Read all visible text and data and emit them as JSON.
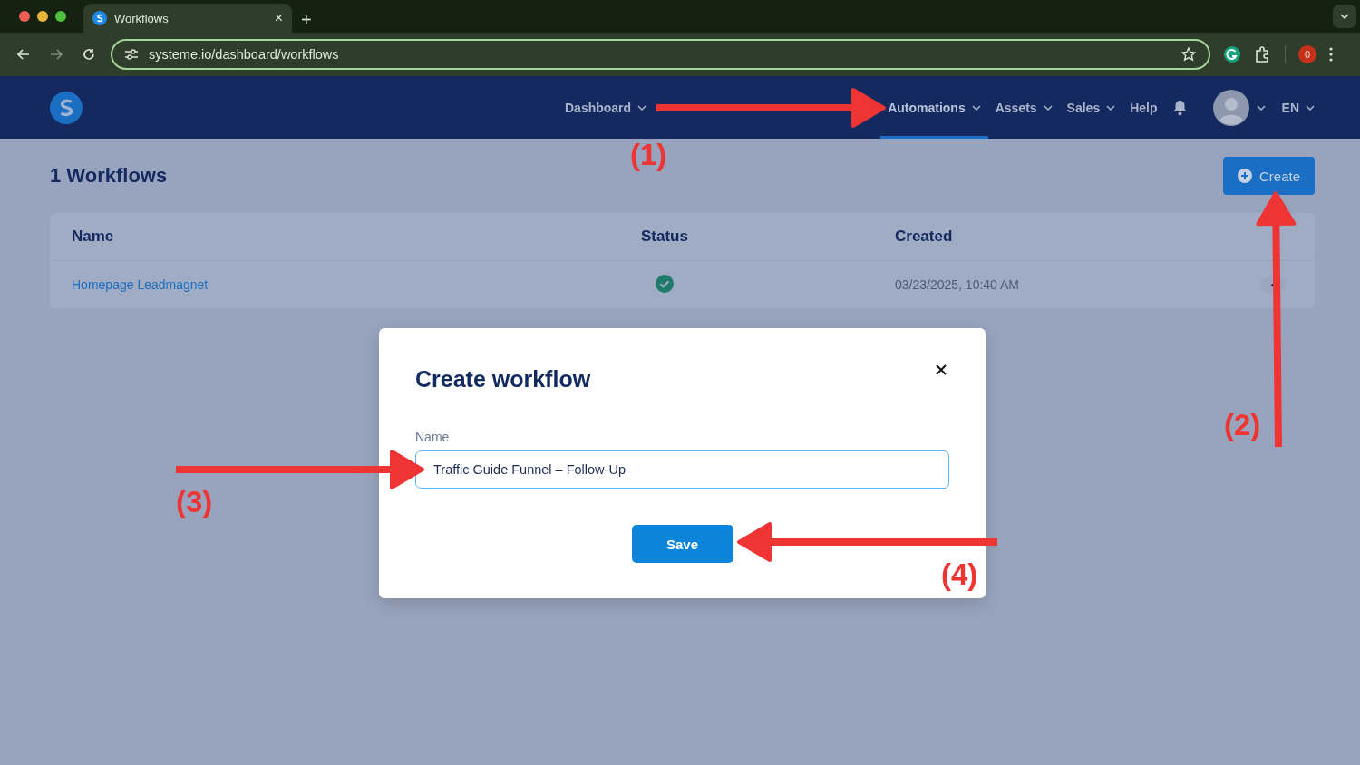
{
  "browser": {
    "tab_title": "Workflows",
    "close_tab": "×",
    "new_tab": "+",
    "url": "systeme.io/dashboard/workflows",
    "extension_badge": "0"
  },
  "nav": {
    "items": [
      {
        "label": "Dashboard",
        "selected": false,
        "dropdown": true
      },
      {
        "label": "Automations",
        "selected": true,
        "dropdown": true
      },
      {
        "label": "Assets",
        "selected": false,
        "dropdown": true
      },
      {
        "label": "Sales",
        "selected": false,
        "dropdown": true
      },
      {
        "label": "Help",
        "selected": false,
        "dropdown": false
      }
    ],
    "language": "EN"
  },
  "page": {
    "title": "1 Workflows",
    "create_button": "Create",
    "table": {
      "columns": [
        "Name",
        "Status",
        "Created"
      ],
      "rows": [
        {
          "name": "Homepage Leadmagnet",
          "active": true,
          "created": "03/23/2025, 10:40 AM"
        }
      ]
    }
  },
  "dialog": {
    "title": "Create workflow",
    "field_label": "Name",
    "field_value": "Traffic Guide Funnel – Follow-Up",
    "save_button": "Save"
  },
  "annotations": [
    {
      "label": "(1)"
    },
    {
      "label": "(2)"
    },
    {
      "label": "(3)"
    },
    {
      "label": "(4)"
    }
  ]
}
